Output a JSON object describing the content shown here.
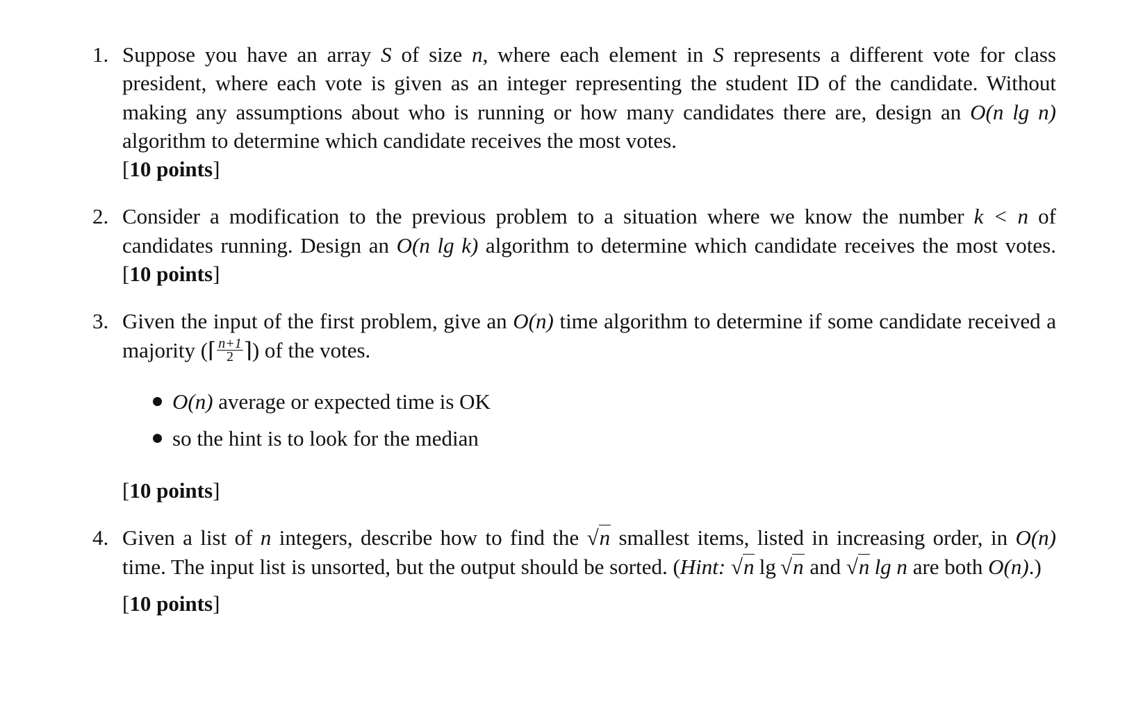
{
  "problems": [
    {
      "number": "1.",
      "text_parts": {
        "a": "Suppose you have an array ",
        "S1": "S",
        "b": " of size ",
        "n1": "n",
        "c": ", where each element in ",
        "S2": "S",
        "d": " represents a different vote for class president, where each vote is given as an integer representing the student ID of the candidate. Without making any assumptions about who is running or how many candidates there are, design an ",
        "complexity": "O(n lg n)",
        "e": " algorithm to determine which candidate receives the most votes."
      },
      "points": "10 points"
    },
    {
      "number": "2.",
      "text_parts": {
        "a": "Consider a modification to the previous problem to a situation where we know the number ",
        "cond": "k < n",
        "b": " of candidates running. Design an ",
        "complexity": "O(n lg k)",
        "c": " algorithm to determine which candidate receives the most votes. "
      },
      "points": "10 points"
    },
    {
      "number": "3.",
      "text_parts": {
        "a": "Given the input of the first problem, give an ",
        "complexity": "O(n)",
        "b": " time algorithm to determine if some candidate received a majority (",
        "frac_num": "n+1",
        "frac_den": "2",
        "c": ") of the votes."
      },
      "bullets": [
        {
          "math": "O(n)",
          "text": " average or expected time is OK"
        },
        {
          "math": "",
          "text": "so the hint is to look for the median"
        }
      ],
      "points": "10 points"
    },
    {
      "number": "4.",
      "text_parts": {
        "a": "Given a list of ",
        "n1": "n",
        "b": " integers, describe how to find the ",
        "sqrt_n": "n",
        "c": " smallest items, listed in increasing order, in ",
        "complexity": "O(n)",
        "d": " time. The input list is unsorted, but the output should be sorted. (",
        "hint_label": "Hint:",
        "e": " ",
        "h1_tail": "lg",
        "f": " and ",
        "h2_tail": "lg n",
        "g": " are both ",
        "complexity2": "O(n)",
        "h": ".)"
      },
      "points": "10 points"
    }
  ]
}
